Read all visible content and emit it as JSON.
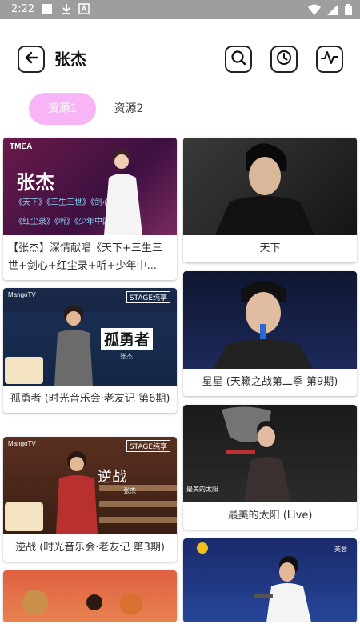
{
  "status_bar": {
    "time": "2:22",
    "icons": [
      "square-notification-icon",
      "download-icon",
      "a-notification-icon",
      "wifi-icon",
      "signal-icon",
      "battery-icon"
    ]
  },
  "header": {
    "title": "张杰",
    "icons": [
      "back-arrow-icon",
      "search-icon",
      "history-clock-icon",
      "waveform-icon"
    ]
  },
  "tabs": [
    {
      "label": "资源1",
      "active": true
    },
    {
      "label": "资源2",
      "active": false
    }
  ],
  "cards": [
    {
      "title": "【张杰】深情献唱《天下+三生三世+剑心+红尘录+听+少年中...",
      "thumb_text": {
        "brand": "TMEA",
        "name": "张杰",
        "line1": "《天下》《三生三世》《剑心》",
        "line2": "《红尘录》《听》《少年中国说》"
      }
    },
    {
      "title": "天下"
    },
    {
      "title": "孤勇者 (时光音乐会·老友记 第6期)",
      "thumb_text": {
        "brand": "MangoTV",
        "badge": "STAGE纯享",
        "song": "孤勇者",
        "sub": "张杰"
      }
    },
    {
      "title": "星星 (天籁之战第二季 第9期)"
    },
    {
      "title": "逆战 (时光音乐会·老友记 第3期)",
      "thumb_text": {
        "brand": "MangoTV",
        "badge": "STAGE纯享",
        "song": "逆战",
        "sub": "张杰"
      }
    },
    {
      "title": "最美的太阳 (Live)",
      "thumb_text": {
        "caption": "最美的太阳"
      }
    },
    {
      "title": ""
    },
    {
      "title": "",
      "thumb_text": {
        "corner": "芙蓉"
      }
    }
  ],
  "colors": {
    "accent_tab": "#f7b4f7",
    "statusbar": "#9e9e9e"
  }
}
